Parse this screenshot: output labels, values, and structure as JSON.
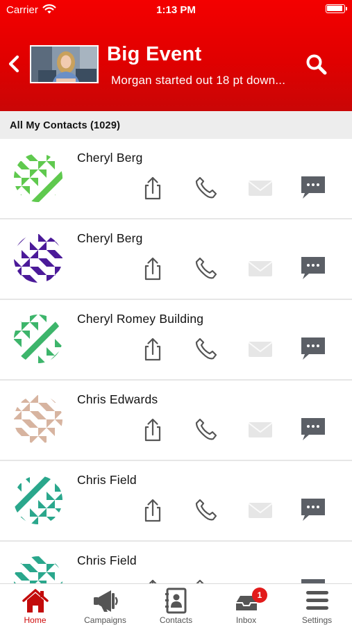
{
  "status_bar": {
    "carrier": "Carrier",
    "time": "1:13 PM"
  },
  "header": {
    "title": "Big Event",
    "subtitle": "Morgan started out 18 pt down..."
  },
  "section": {
    "title": "All My Contacts (1029)"
  },
  "contacts": [
    {
      "name": "Cheryl Berg",
      "avatar_color": "#5fc94e"
    },
    {
      "name": "Cheryl Berg",
      "avatar_color": "#4b1a99"
    },
    {
      "name": "Cheryl Romey Building",
      "avatar_color": "#3db56b"
    },
    {
      "name": "Chris Edwards",
      "avatar_color": "#d7b4a0"
    },
    {
      "name": "Chris Field",
      "avatar_color": "#2aa78c"
    },
    {
      "name": "Chris Field",
      "avatar_color": "#2aa78c"
    }
  ],
  "tabs": [
    {
      "label": "Home",
      "icon": "home-icon",
      "active": true
    },
    {
      "label": "Campaigns",
      "icon": "megaphone-icon"
    },
    {
      "label": "Contacts",
      "icon": "contacts-book-icon"
    },
    {
      "label": "Inbox",
      "icon": "inbox-icon",
      "badge": "1"
    },
    {
      "label": "Settings",
      "icon": "menu-icon"
    }
  ],
  "colors": {
    "header_red": "#e60000",
    "active_tab": "#cf0b0b",
    "icon_gray": "#555555",
    "mail_disabled": "#e6e6e6",
    "badge_red": "#e21b1b"
  }
}
